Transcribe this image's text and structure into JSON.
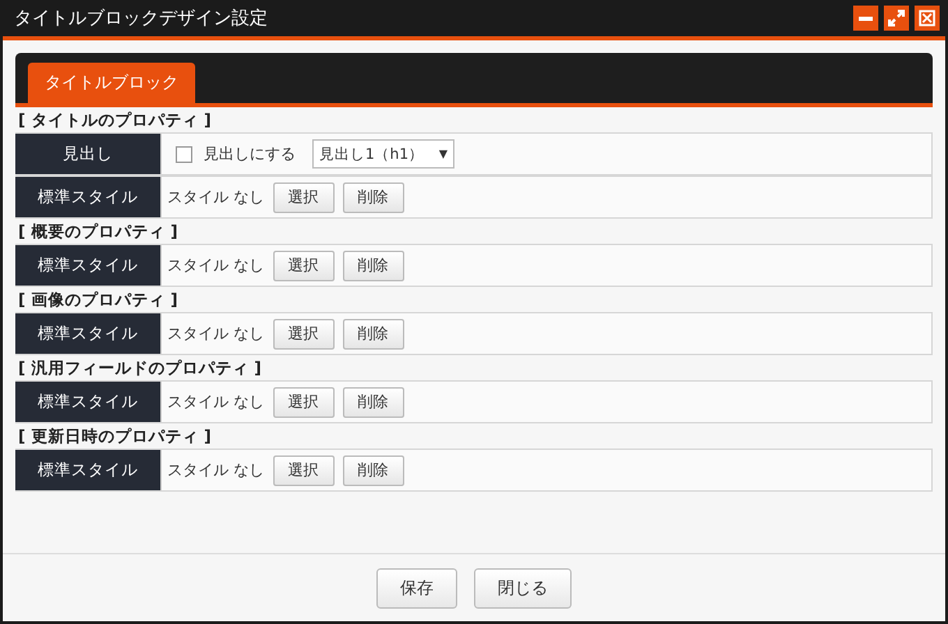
{
  "window": {
    "title": "タイトルブロックデザイン設定",
    "controls": [
      {
        "kind": "minimize"
      },
      {
        "kind": "maximize"
      },
      {
        "kind": "close"
      }
    ]
  },
  "tabs": [
    {
      "label": "タイトルブロック",
      "selected": true
    }
  ],
  "sections": [
    {
      "title": "[ タイトルのプロパティ ]",
      "rows": [
        {
          "kind": "heading",
          "label": "見出し",
          "checkbox_label": "見出しにする",
          "checked": false,
          "select_value": "見出し1（h1）",
          "select_arrow": "▼"
        },
        {
          "kind": "style",
          "label": "標準スタイル",
          "value": "スタイル なし",
          "buttons": [
            "選択",
            "削除"
          ]
        }
      ]
    },
    {
      "title": "[ 概要のプロパティ ]",
      "rows": [
        {
          "kind": "style",
          "label": "標準スタイル",
          "value": "スタイル なし",
          "buttons": [
            "選択",
            "削除"
          ]
        }
      ]
    },
    {
      "title": "[ 画像のプロパティ ]",
      "rows": [
        {
          "kind": "style",
          "label": "標準スタイル",
          "value": "スタイル なし",
          "buttons": [
            "選択",
            "削除"
          ]
        }
      ]
    },
    {
      "title": "[ 汎用フィールドのプロパティ ]",
      "rows": [
        {
          "kind": "style",
          "label": "標準スタイル",
          "value": "スタイル なし",
          "buttons": [
            "選択",
            "削除"
          ]
        }
      ]
    },
    {
      "title": "[ 更新日時のプロパティ ]",
      "rows": [
        {
          "kind": "style",
          "label": "標準スタイル",
          "value": "スタイル なし",
          "buttons": [
            "選択",
            "削除"
          ]
        }
      ]
    }
  ],
  "footer_buttons": [
    "保存",
    "閉じる"
  ]
}
